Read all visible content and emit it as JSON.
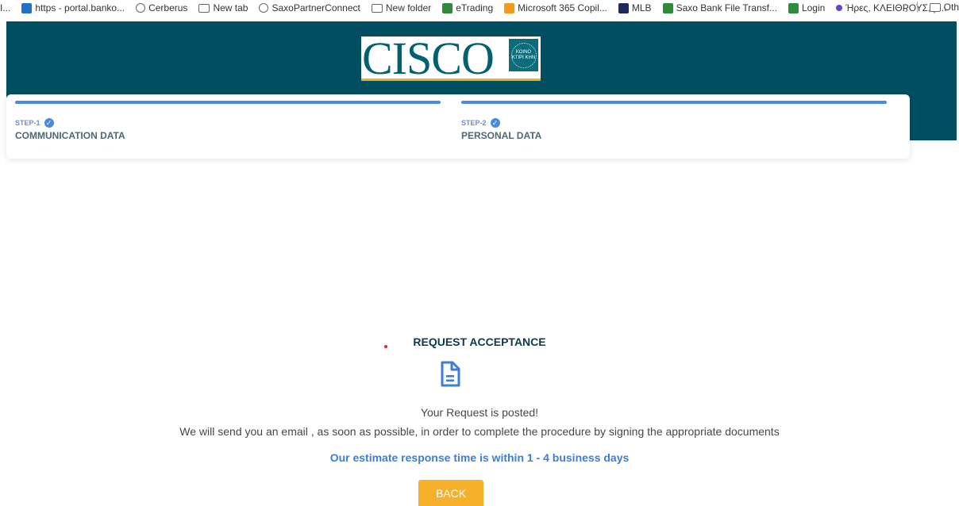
{
  "bookmarks": [
    {
      "icon": "generic-icon",
      "label": "I..."
    },
    {
      "icon": "portal-icon",
      "label": "https - portal.banko..."
    },
    {
      "icon": "globe-icon",
      "label": "Cerberus"
    },
    {
      "icon": "new-tab-icon",
      "label": "New tab"
    },
    {
      "icon": "globe-icon",
      "label": "SaxoPartnerConnect"
    },
    {
      "icon": "folder-icon",
      "label": "New folder"
    },
    {
      "icon": "etrading-icon",
      "label": "eTrading"
    },
    {
      "icon": "office-icon",
      "label": "Microsoft 365 Copil..."
    },
    {
      "icon": "mlb-icon",
      "label": "MLB"
    },
    {
      "icon": "saxo-icon",
      "label": "Saxo Bank File Transf..."
    },
    {
      "icon": "login-icon",
      "label": "Login"
    },
    {
      "icon": "dot-icon",
      "label": "Ήρες, ΚΛΕΙΘΡΟΥΣ, ρ..."
    }
  ],
  "bookmarks_other": "Oth",
  "logo": {
    "text": "CISCO",
    "emblem_text": "ΚΟΙΝΟ ΚΤΙΡΙ ΚΗΝ"
  },
  "steps": [
    {
      "num": "STEP-1",
      "title": "COMMUNICATION DATA"
    },
    {
      "num": "STEP-2",
      "title": "PERSONAL DATA"
    }
  ],
  "content": {
    "title": "REQUEST ACCEPTANCE",
    "posted": "Your Request is posted!",
    "email_note": "We will send you an email , as soon as possible, in order to complete the procedure by signing the appropriate documents",
    "estimate": "Our estimate response time is within 1 - 4 business days",
    "back_label": "BACK"
  },
  "colors": {
    "header_bg": "#004e60",
    "accent_blue": "#4a8be0",
    "button_bg": "#f5b12b",
    "estimate_text": "#3c7fd5"
  }
}
